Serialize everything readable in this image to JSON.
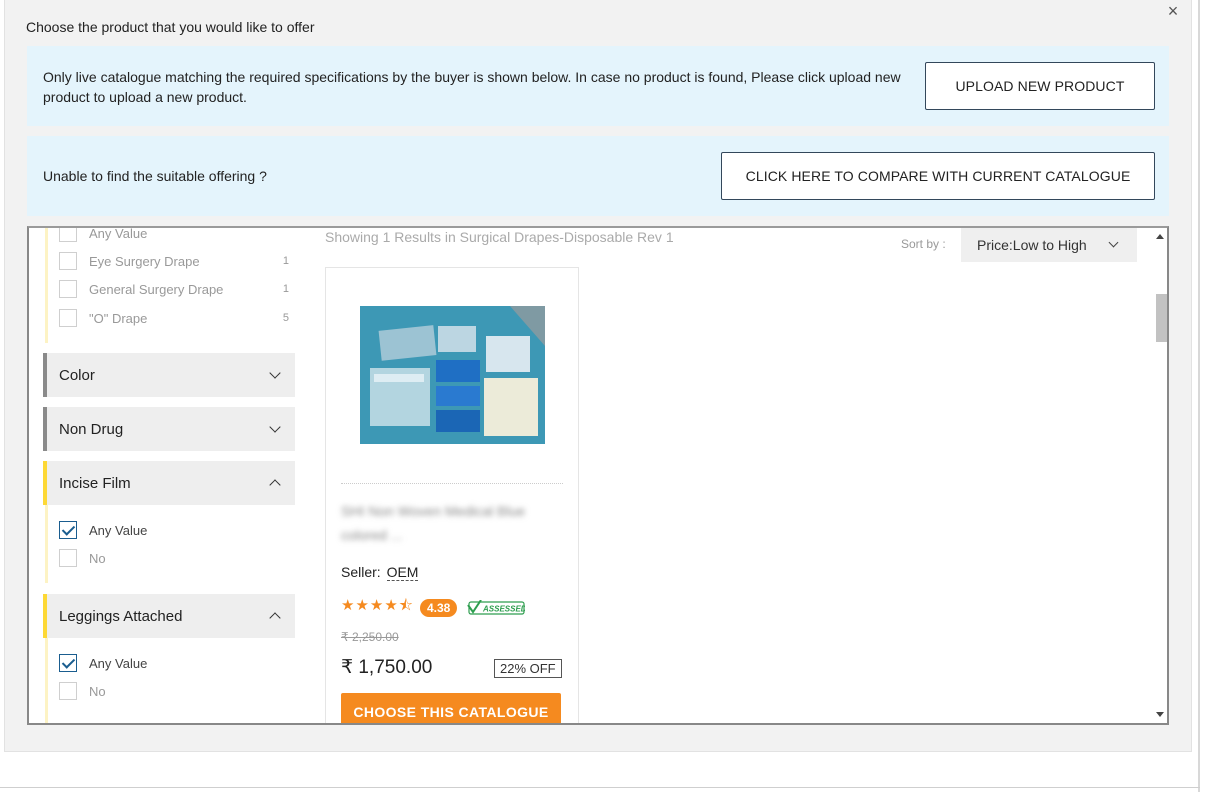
{
  "modal": {
    "title": "Choose the product that you would like to offer",
    "close_glyph": "×"
  },
  "info_panel": {
    "text": "Only live catalogue matching the required specifications by the buyer is shown below. In case no product is found, Please click upload new product to upload a new product.",
    "upload_button": "UPLOAD NEW PRODUCT"
  },
  "compare_panel": {
    "text": "Unable to find the suitable offering ?",
    "compare_button": "CLICK HERE TO COMPARE WITH CURRENT CATALOGUE"
  },
  "sidebar": {
    "top_options": [
      {
        "label": "Any Value",
        "count": ""
      },
      {
        "label": "Eye Surgery Drape",
        "count": "1"
      },
      {
        "label": "General Surgery Drape",
        "count": "1"
      },
      {
        "label": "\"O\" Drape",
        "count": "5"
      }
    ],
    "filters": [
      {
        "title": "Color",
        "expanded": false
      },
      {
        "title": "Non Drug",
        "expanded": false
      },
      {
        "title": "Incise Film",
        "expanded": true
      },
      {
        "title": "Leggings Attached",
        "expanded": true
      }
    ],
    "incise_film_options": [
      {
        "label": "Any Value",
        "checked": true
      },
      {
        "label": "No",
        "checked": false
      }
    ],
    "leggings_options": [
      {
        "label": "Any Value",
        "checked": true
      },
      {
        "label": "No",
        "checked": false
      }
    ]
  },
  "results": {
    "header": "Showing 1 Results in Surgical Drapes-Disposable Rev 1",
    "sort_label": "Sort by :",
    "sort_value": "Price:Low to High"
  },
  "product": {
    "title": "SHI Non Woven Medical Blue colored ...",
    "seller_label": "Seller:",
    "seller_name": "OEM",
    "stars": "★★★★⯪",
    "rating": "4.38",
    "assessed_label": "ASSESSED",
    "mrp": "₹ 2,250.00",
    "price": "₹ 1,750.00",
    "discount": "22% OFF",
    "choose_button": "CHOOSE THIS CATALOGUE"
  },
  "colors": {
    "accent_orange": "#f58a1f",
    "info_bg": "#e4f4fc",
    "check_blue": "#1a5d8f",
    "open_filter_border": "#fdd835",
    "assessed_green": "#2e9e4f"
  }
}
